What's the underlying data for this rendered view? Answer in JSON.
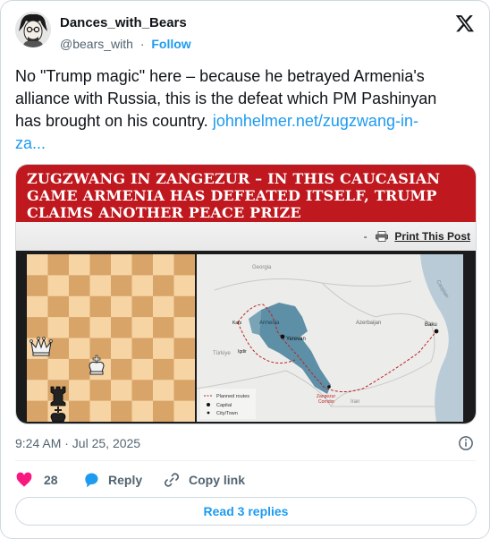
{
  "author": {
    "display_name": "Dances_with_Bears",
    "handle": "@bears_with",
    "separator": "·",
    "follow_label": "Follow"
  },
  "tweet": {
    "text_lines": [
      "No \"Trump magic\" here – because he betrayed Armenia's",
      "alliance with Russia, this is the defeat which PM Pashinyan",
      "has brought on his country."
    ],
    "link_part1": "johnhelmer.net/zugzwang-in-",
    "link_part2": "za...",
    "timestamp": "9:24 AM · Jul 25, 2025"
  },
  "media": {
    "headline_lines": [
      "ZUGZWANG IN ZANGEZUR – IN THIS CAUCASIAN",
      "GAME ARMENIA HAS DEFEATED ITSELF, TRUMP",
      "CLAIMS ANOTHER PEACE PRIZE"
    ],
    "print_prefix": "-",
    "print_label": "Print This Post",
    "map_labels": {
      "georgia": "Georgia",
      "armenia": "Armenia",
      "azerbaijan": "Azerbaijan",
      "yerevan": "Yerevan",
      "baku": "Baku",
      "turkiye": "Türkiye",
      "iran": "Iran",
      "caspian": "Caspian",
      "zangezur": "Zangezur",
      "corridor": "Corridor",
      "kars": "Kars",
      "igdir": "Igdir"
    },
    "legend": [
      "Planned routes",
      "Capital",
      "City/Town"
    ]
  },
  "actions": {
    "like_count": "28",
    "reply_label": "Reply",
    "copy_label": "Copy link",
    "read_replies_label": "Read 3 replies"
  },
  "colors": {
    "link": "#1d9bf0",
    "like": "#f91880",
    "banner": "#c0181f",
    "armenia": "#5d8fa6"
  }
}
